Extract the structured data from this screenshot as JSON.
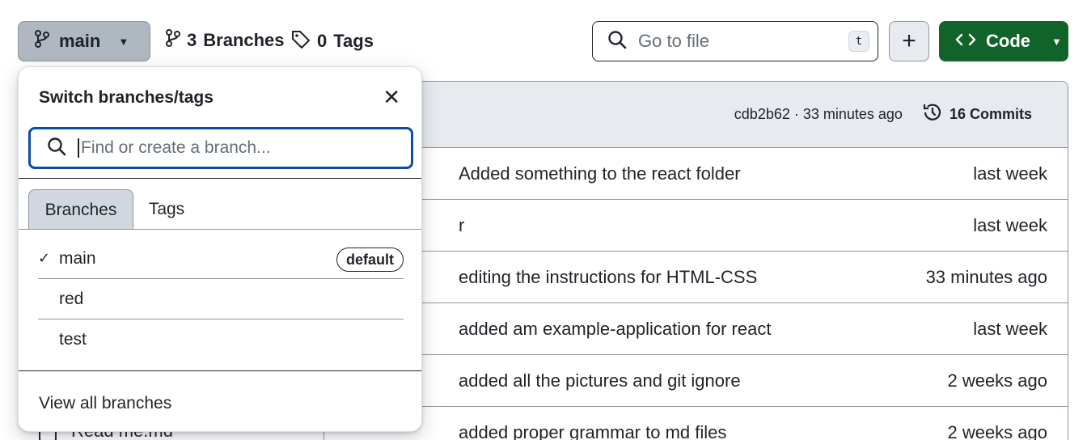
{
  "toolbar": {
    "branch_button_label": "main",
    "branches_count": "3",
    "branches_label": "Branches",
    "tags_count": "0",
    "tags_label": "Tags",
    "goto_placeholder": "Go to file",
    "goto_shortcut": "t",
    "code_label": "Code"
  },
  "table": {
    "commit_sha_time": "cdb2b62 · 33 minutes ago",
    "commits_label": "16 Commits",
    "rows": [
      {
        "message": "Added something to the react folder",
        "time": "last week"
      },
      {
        "message": "r",
        "time": "last week"
      },
      {
        "message": "editing the instructions for HTML-CSS",
        "time": "33 minutes ago"
      },
      {
        "message": "added am example-application for react",
        "time": "last week"
      },
      {
        "message": "added all the pictures and git ignore",
        "time": "2 weeks ago"
      },
      {
        "message": "added proper grammar to md files",
        "time": "2 weeks ago"
      }
    ],
    "peek_file_name": "Read me.md"
  },
  "branch_panel": {
    "title": "Switch branches/tags",
    "search_placeholder": "Find or create a branch...",
    "tabs": [
      "Branches",
      "Tags"
    ],
    "branches": [
      {
        "name": "main",
        "badge": "default",
        "selected": true
      },
      {
        "name": "red"
      },
      {
        "name": "test"
      }
    ],
    "view_all_label": "View all branches"
  },
  "colors": {
    "code_button": "#116329",
    "focus_ring": "#0a4da2",
    "header_bg": "#e7ebef"
  }
}
